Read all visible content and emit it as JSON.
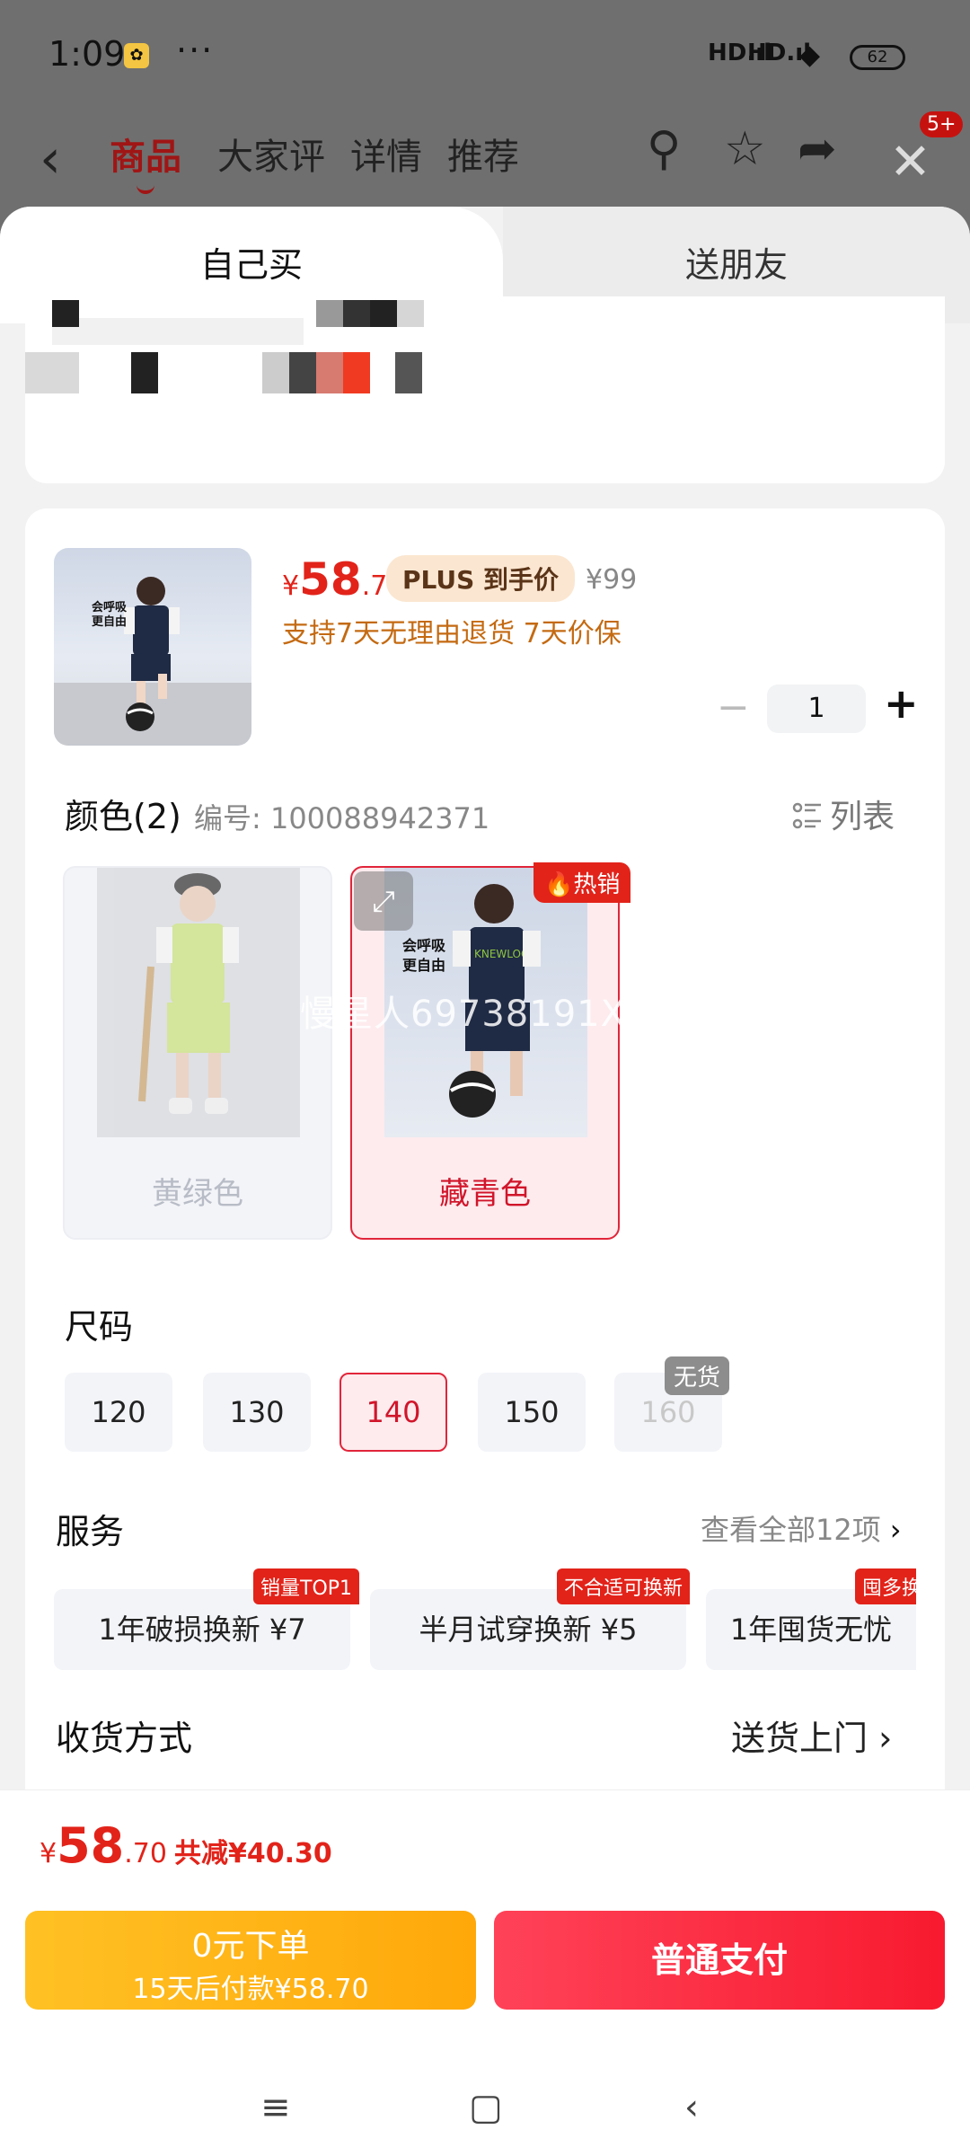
{
  "status": {
    "time": "1:09",
    "more": "···",
    "signal1": "HD.ıl",
    "signal2": "HD.ıl",
    "battery": "62"
  },
  "nav": {
    "tabs": [
      "商品",
      "大家评",
      "详情",
      "推荐"
    ],
    "badge": "5+"
  },
  "sheet": {
    "tabs": {
      "self": "自己买",
      "gift": "送朋友"
    },
    "product": {
      "img_text": "会呼吸\n更自由",
      "price_currency": "¥",
      "price_int": "58",
      "price_dec": ".7",
      "plus_tag": "PLUS 到手价",
      "original_price": "¥99",
      "promise": "支持7天无理由退货  7天价保",
      "quantity": "1",
      "qty_minus": "−",
      "qty_plus": "+"
    },
    "color": {
      "label": "颜色(2)",
      "sku": "编号: 100088942371",
      "list_btn": "列表",
      "options": [
        {
          "name": "黄绿色",
          "state": "disabled"
        },
        {
          "name": "藏青色",
          "state": "selected",
          "tag": "热销"
        }
      ],
      "watermark": "慢星人69738191X"
    },
    "size": {
      "label": "尺码",
      "options": [
        "120",
        "130",
        "140",
        "150",
        "160"
      ],
      "selected": "140",
      "oos_tag": "无货"
    },
    "service": {
      "label": "服务",
      "view_all": "查看全部12项",
      "items": [
        {
          "name": "1年破损换新  ¥7",
          "tag": "销量TOP1"
        },
        {
          "name": "半月试穿换新  ¥5",
          "tag": "不合适可换新"
        },
        {
          "name": "1年囤货无忧",
          "tag": "囤多换"
        }
      ]
    },
    "shipping": {
      "label": "收货方式",
      "value": "送货上门"
    }
  },
  "bottom": {
    "total_currency": "¥",
    "total_int": "58",
    "total_dec": ".70",
    "total_save": "共减¥40.30",
    "btn_later_l1": "0元下单",
    "btn_later_l2": "15天后付款¥58.70",
    "btn_pay": "普通支付"
  },
  "colors": {
    "accent": "#e2231a",
    "selected_bg": "#fdebee",
    "later_btn": "#ffb316",
    "pay_btn": "#fb2d42"
  }
}
